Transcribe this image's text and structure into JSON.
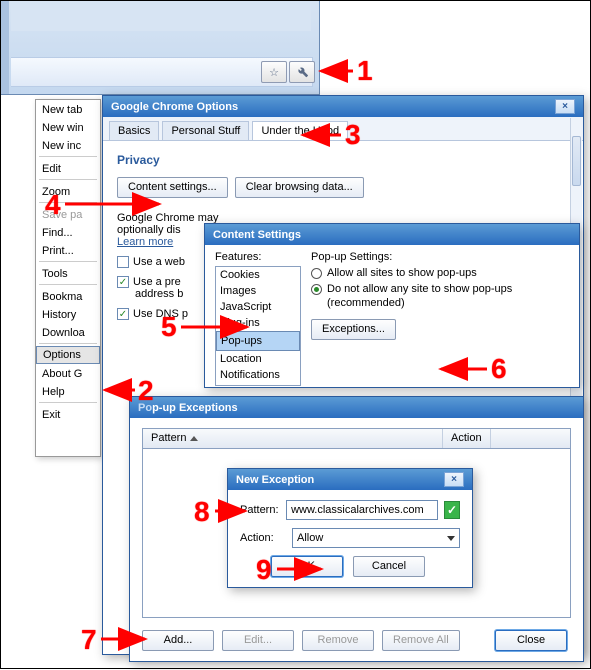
{
  "browser": {
    "star_icon": "star-icon",
    "wrench_icon": "wrench-icon"
  },
  "context_menu": {
    "items": [
      "New tab",
      "New win",
      "New inc"
    ],
    "items2": [
      "Edit"
    ],
    "items3": [
      "Zoom"
    ],
    "items4": [
      "Save pa",
      "Find...",
      "Print...",
      "Tools"
    ],
    "items5": [
      "Bookma",
      "History",
      "Downloa"
    ],
    "items6": [
      "Options",
      "About G",
      "Help"
    ],
    "items7": [
      "Exit"
    ]
  },
  "options_window": {
    "title": "Google Chrome Options",
    "tabs": [
      "Basics",
      "Personal Stuff",
      "Under the Hood"
    ],
    "active_tab": 2,
    "privacy": {
      "title": "Privacy",
      "content_settings_btn": "Content settings...",
      "clear_browsing_btn": "Clear browsing data...",
      "para": "Google Chrome may optionally dis",
      "learn_more": "Learn more",
      "cb1": "Use a web",
      "cb2": "Use a pre",
      "cb2b": "address b",
      "cb3": "Use DNS p"
    }
  },
  "content_settings": {
    "title": "Content Settings",
    "features_label": "Features:",
    "features": [
      "Cookies",
      "Images",
      "JavaScript",
      "Plug-ins",
      "Pop-ups",
      "Location",
      "Notifications"
    ],
    "selected_feature": 4,
    "popup_heading": "Pop-up Settings:",
    "radio_allow": "Allow all sites to show pop-ups",
    "radio_block": "Do not allow any site to show pop-ups (recommended)",
    "radio_block_line2": "(recommended)",
    "radio_block_line1": "Do not allow any site to show pop-ups",
    "exceptions_btn": "Exceptions..."
  },
  "exceptions": {
    "title": "Pop-up Exceptions",
    "col_pattern": "Pattern",
    "col_action": "Action",
    "add_btn": "Add...",
    "edit_btn": "Edit...",
    "remove_btn": "Remove",
    "removeall_btn": "Remove All",
    "close_btn": "Close"
  },
  "new_exception": {
    "title": "New Exception",
    "pattern_label": "Pattern:",
    "pattern_value": "www.classicalarchives.com",
    "action_label": "Action:",
    "action_value": "Allow",
    "ok_btn": "OK",
    "cancel_btn": "Cancel"
  },
  "annotations": {
    "n1": "1",
    "n2": "2",
    "n3": "3",
    "n4": "4",
    "n5": "5",
    "n6": "6",
    "n7": "7",
    "n8": "8",
    "n9": "9"
  }
}
